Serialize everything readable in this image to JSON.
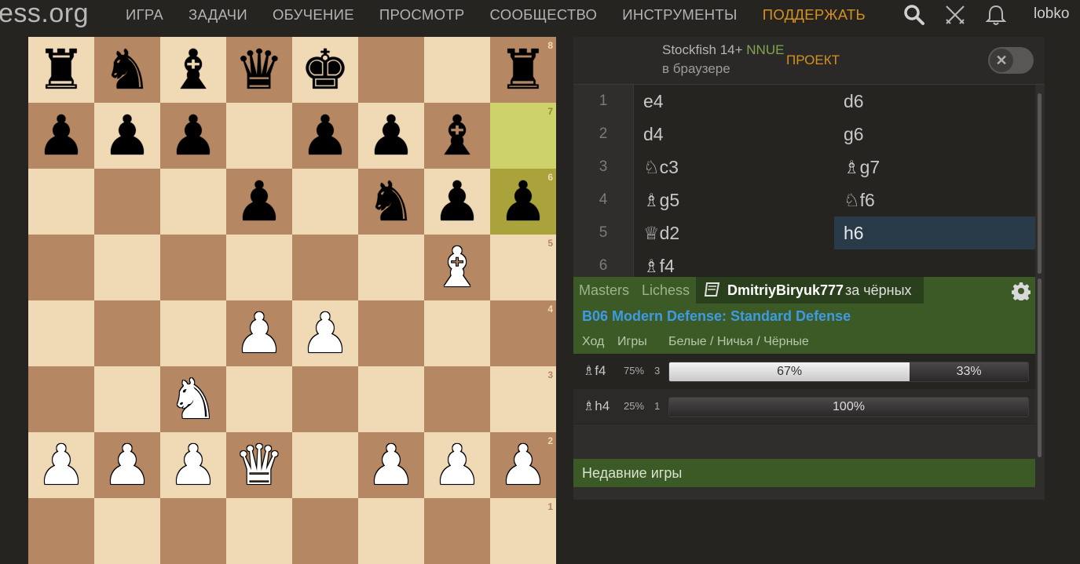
{
  "header": {
    "logo": "ess.org",
    "nav": [
      "ИГРА",
      "ЗАДАЧИ",
      "ОБУЧЕНИЕ",
      "ПРОСМОТР",
      "СООБЩЕСТВО",
      "ИНСТРУМЕНТЫ",
      "ПОДДЕРЖАТЬ"
    ],
    "icons": [
      "search-icon",
      "crossed-swords-icon",
      "bell-icon"
    ],
    "username": "lobko"
  },
  "board": {
    "ranks": [
      [
        "r",
        "n",
        "b",
        "q",
        "k",
        "",
        "",
        "r"
      ],
      [
        "p",
        "p",
        "p",
        "",
        "p",
        "p",
        "b",
        ""
      ],
      [
        "",
        "",
        "",
        "p",
        "",
        "n",
        "p",
        "p"
      ],
      [
        "",
        "",
        "",
        "",
        "",
        "",
        "B",
        ""
      ],
      [
        "",
        "",
        "",
        "P",
        "P",
        "",
        "",
        ""
      ],
      [
        "",
        "",
        "N",
        "",
        "",
        "",
        "",
        ""
      ],
      [
        "P",
        "P",
        "P",
        "Q",
        "",
        "P",
        "P",
        "P"
      ],
      [
        "",
        "",
        "",
        "",
        "",
        "",
        "",
        ""
      ]
    ],
    "highlight": [
      "h7",
      "h6"
    ],
    "rank_labels": [
      "8",
      "7",
      "6",
      "5",
      "4",
      "3",
      "2",
      "1"
    ]
  },
  "engine": {
    "name": "Stockfish 14+",
    "nnue": "NNUE",
    "project": "ПРОЕКТ",
    "subtitle": "в браузере",
    "toggle_icon": "close-icon"
  },
  "moves": [
    {
      "num": "1",
      "white": "e4",
      "black": "d6"
    },
    {
      "num": "2",
      "white": "d4",
      "black": "g6"
    },
    {
      "num": "3",
      "white": "♘c3",
      "black": "♗g7"
    },
    {
      "num": "4",
      "white": "♗g5",
      "black": "♘f6"
    },
    {
      "num": "5",
      "white": "♕d2",
      "black": "h6"
    },
    {
      "num": "6",
      "white": "♗f4",
      "black": ""
    }
  ],
  "active_move": {
    "row": 4,
    "side": "black"
  },
  "explorer": {
    "tabs": [
      "Masters",
      "Lichess"
    ],
    "player_name": "DmitriyBiryuk777",
    "player_side": "за чёрных",
    "opening": "B06 Modern Defense: Standard Defense",
    "columns": [
      "Ход",
      "Игры",
      "Белые / Ничья / Чёрные"
    ],
    "rows": [
      {
        "move": "♗f4",
        "pct": "75%",
        "games": "3",
        "white": "67%",
        "black": "33%",
        "white_frac": 0.67,
        "black_frac": 0.33
      },
      {
        "move": "♗h4",
        "pct": "25%",
        "games": "1",
        "white": "100%",
        "black": "",
        "white_frac": 0.0,
        "black_frac": 1.0
      }
    ],
    "recent": "Недавние игры"
  },
  "colors": {
    "accent": "#d59120",
    "nnue": "#7fa650",
    "explorer_green": "#3c5a26",
    "opening_blue": "#3d9be5",
    "active_move": "#293a49"
  }
}
